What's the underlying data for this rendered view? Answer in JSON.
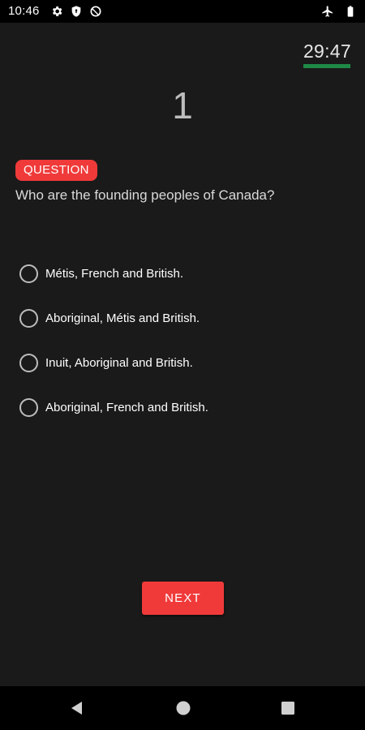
{
  "status_bar": {
    "time": "10:46",
    "left_icons": [
      "gear-icon",
      "shield-icon",
      "data-saver-icon"
    ],
    "right_icons": [
      "airplane-icon",
      "battery-icon"
    ]
  },
  "timer": {
    "text": "29:47",
    "bar_color": "#1e8a47"
  },
  "question": {
    "number": "1",
    "badge_label": "QUESTION",
    "text": "Who are the founding peoples of Canada?"
  },
  "options": [
    {
      "label": "Métis, French and British."
    },
    {
      "label": "Aboriginal, Métis and British."
    },
    {
      "label": "Inuit, Aboriginal and British."
    },
    {
      "label": "Aboriginal, French and British."
    }
  ],
  "next_button": {
    "label": "NEXT"
  },
  "nav_bar": {
    "buttons": [
      "back-icon",
      "home-icon",
      "recents-icon"
    ]
  },
  "colors": {
    "accent": "#f03a3a",
    "background": "#1a1a1a",
    "timer_bar": "#1e8a47"
  }
}
